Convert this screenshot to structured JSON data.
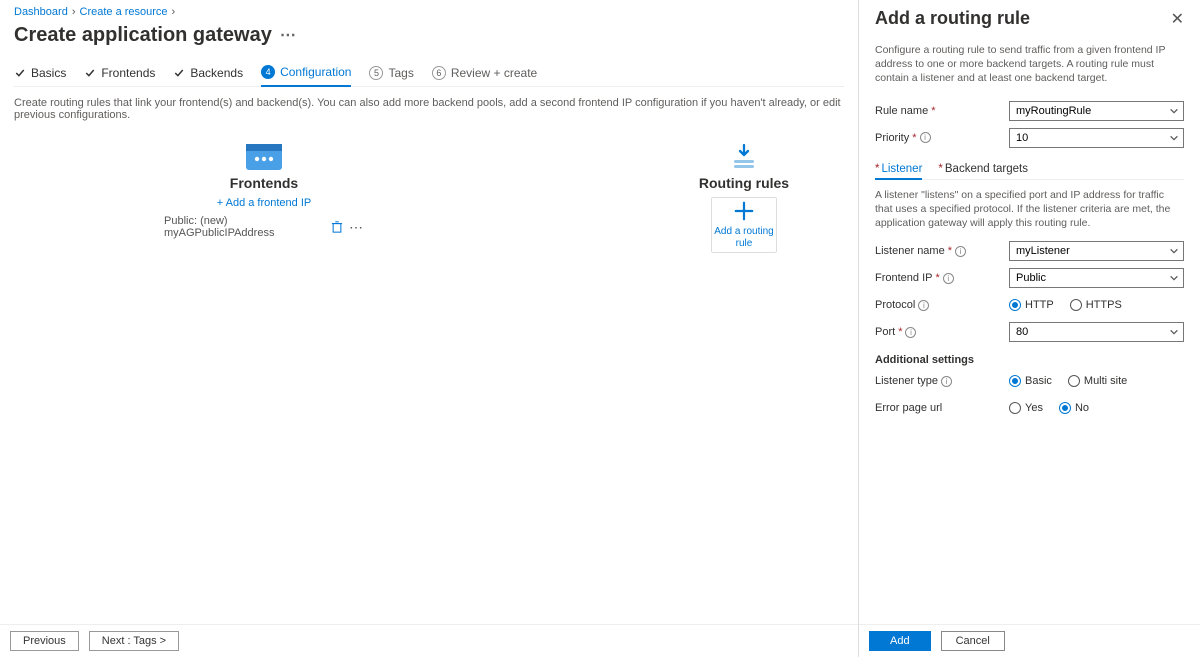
{
  "breadcrumb": {
    "items": [
      "Dashboard",
      "Create a resource"
    ]
  },
  "page_title": "Create application gateway",
  "steps": {
    "basics": "Basics",
    "frontends": "Frontends",
    "backends": "Backends",
    "configuration": "Configuration",
    "tags_num": "5",
    "tags": "Tags",
    "review_num": "6",
    "review": "Review + create"
  },
  "description": "Create routing rules that link your frontend(s) and backend(s). You can also add more backend pools, add a second frontend IP configuration if you haven't already, or edit previous configurations.",
  "frontends": {
    "title": "Frontends",
    "add_link": "+ Add a frontend IP",
    "item0": "Public: (new) myAGPublicIPAddress"
  },
  "routing": {
    "title": "Routing rules",
    "add_label": "Add a routing rule"
  },
  "footer": {
    "prev": "Previous",
    "next": "Next : Tags >"
  },
  "panel": {
    "title": "Add a routing rule",
    "desc": "Configure a routing rule to send traffic from a given frontend IP address to one or more backend targets. A routing rule must contain a listener and at least one backend target.",
    "rule_name_label": "Rule name",
    "rule_name_value": "myRoutingRule",
    "priority_label": "Priority",
    "priority_value": "10",
    "tab_listener": "Listener",
    "tab_backend": "Backend targets",
    "listener_desc": "A listener \"listens\" on a specified port and IP address for traffic that uses a specified protocol. If the listener criteria are met, the application gateway will apply this routing rule.",
    "listener_name_label": "Listener name",
    "listener_name_value": "myListener",
    "frontend_ip_label": "Frontend IP",
    "frontend_ip_value": "Public",
    "protocol_label": "Protocol",
    "protocol_http": "HTTP",
    "protocol_https": "HTTPS",
    "port_label": "Port",
    "port_value": "80",
    "additional": "Additional settings",
    "listener_type_label": "Listener type",
    "lt_basic": "Basic",
    "lt_multi": "Multi site",
    "error_page_label": "Error page url",
    "ep_yes": "Yes",
    "ep_no": "No",
    "add_btn": "Add",
    "cancel_btn": "Cancel"
  }
}
